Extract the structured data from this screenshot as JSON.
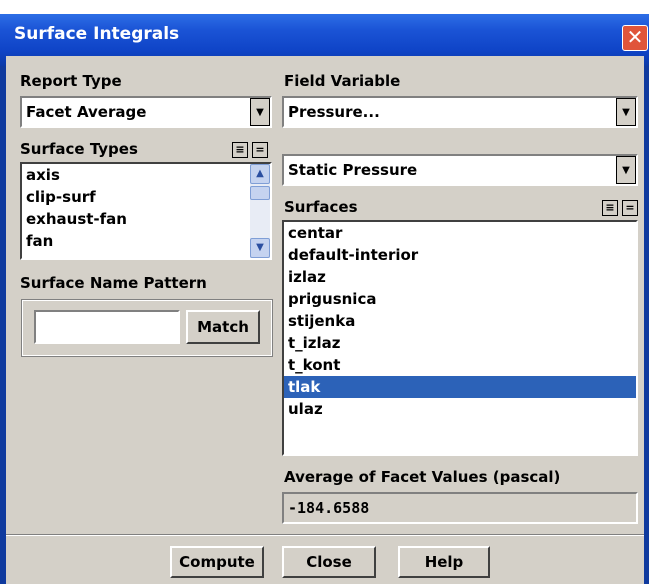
{
  "window": {
    "title": "Surface Integrals"
  },
  "report_type": {
    "label": "Report Type",
    "selected": "Facet Average"
  },
  "field_variable": {
    "label": "Field Variable",
    "selected": "Pressure...",
    "sub_selected": "Static Pressure"
  },
  "surface_types": {
    "label": "Surface Types",
    "items": [
      "axis",
      "clip-surf",
      "exhaust-fan",
      "fan"
    ]
  },
  "surfaces": {
    "label": "Surfaces",
    "items": [
      "centar",
      "default-interior",
      "izlaz",
      "prigusnica",
      "stijenka",
      "t_izlaz",
      "t_kont",
      "tlak",
      "ulaz"
    ],
    "selected_index": 7
  },
  "pattern": {
    "label": "Surface Name Pattern",
    "value": "",
    "match_label": "Match"
  },
  "result": {
    "label": "Average of Facet Values (pascal)",
    "value": "-184.6588"
  },
  "buttons": {
    "compute": "Compute",
    "close": "Close",
    "help": "Help"
  }
}
